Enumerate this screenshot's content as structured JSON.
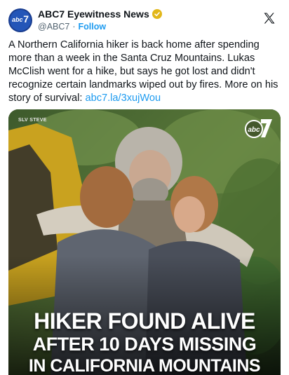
{
  "account": {
    "display_name": "ABC7 Eyewitness News",
    "handle": "@ABC7",
    "separator": "·",
    "follow_label": "Follow",
    "avatar_text": "abc",
    "avatar_number": "7"
  },
  "tweet": {
    "text": "A Northern California hiker is back home after spending more than a week in the Santa Cruz Mountains. Lukas McClish went for a hike, but says he got lost and didn't recognize certain landmarks wiped out by fires. More on his story of survival: ",
    "link_text": "abc7.la/3xujWou"
  },
  "media": {
    "photo_credit": "SLV STEVE",
    "bug_text": "abc",
    "bug_number": "7",
    "headline": [
      "HIKER FOUND ALIVE",
      "AFTER 10 DAYS MISSING",
      "IN CALIFORNIA MOUNTAINS"
    ]
  },
  "icons": {
    "platform": "x-logo-icon",
    "verified": "verified-badge-icon"
  },
  "colors": {
    "link": "#1d9bf0",
    "verified_gold": "#e2b719",
    "avatar_blue": "#1a3d8f"
  }
}
